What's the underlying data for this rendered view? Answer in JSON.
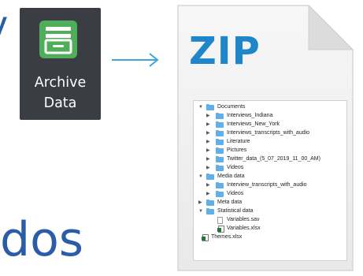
{
  "left_text_fragment_top": "y",
  "left_text_fragment_bottom": "dos",
  "archive_button": {
    "line1": "Archive",
    "line2": "Data",
    "icon": "archive-drawer-icon",
    "icon_color": "#4fae5a"
  },
  "arrow_color": "#3fa6d3",
  "zip_document": {
    "title": "ZIP",
    "title_color": "#1f86ca",
    "tree": [
      {
        "label": "Documents",
        "type": "folder",
        "expanded": true
      },
      {
        "label": "Interviews_Indiana",
        "type": "folder",
        "expanded": false
      },
      {
        "label": "Interviews_New_York",
        "type": "folder",
        "expanded": false
      },
      {
        "label": "Interviews_transcripts_with_audio",
        "type": "folder",
        "expanded": false
      },
      {
        "label": "Literature",
        "type": "folder",
        "expanded": false
      },
      {
        "label": "Pictures",
        "type": "folder",
        "expanded": false
      },
      {
        "label": "Twitter_data_(5_07_2019_11_00_AM)",
        "type": "folder",
        "expanded": false
      },
      {
        "label": "Videos",
        "type": "folder",
        "expanded": false
      },
      {
        "label": "Media data",
        "type": "folder",
        "expanded": true
      },
      {
        "label": "Interview_transcripts_with_audio",
        "type": "folder",
        "expanded": false
      },
      {
        "label": "Videos",
        "type": "folder",
        "expanded": false
      },
      {
        "label": "Meta data",
        "type": "folder",
        "expanded": false
      },
      {
        "label": "Statistical data",
        "type": "folder",
        "expanded": true
      },
      {
        "label": "Variables.sav",
        "type": "file"
      },
      {
        "label": "Variables.xlsx",
        "type": "xlsx"
      },
      {
        "label": "Themes.xlsx",
        "type": "xlsx"
      }
    ]
  }
}
